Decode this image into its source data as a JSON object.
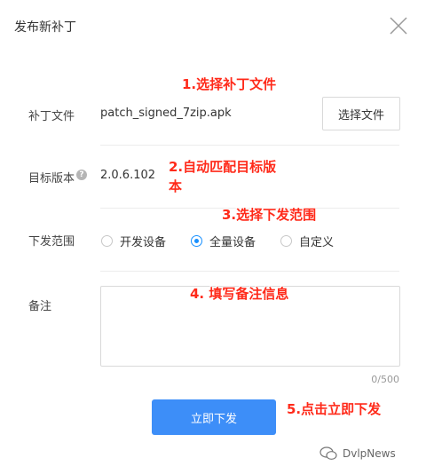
{
  "dialog": {
    "title": "发布新补丁"
  },
  "patch_file": {
    "label": "补丁文件",
    "filename": "patch_signed_7zip.apk",
    "choose_button": "选择文件"
  },
  "target_version": {
    "label": "目标版本",
    "help": "?",
    "value": "2.0.6.102"
  },
  "scope": {
    "label": "下发范围",
    "options": [
      {
        "label": "开发设备",
        "selected": false
      },
      {
        "label": "全量设备",
        "selected": true
      },
      {
        "label": "自定义",
        "selected": false
      }
    ]
  },
  "remark": {
    "label": "备注",
    "value": "",
    "counter": "0/500"
  },
  "submit": {
    "label": "立即下发"
  },
  "annotations": {
    "step1": "1.选择补丁文件",
    "step2_line1": "2.自动匹配目标版",
    "step2_line2": "本",
    "step3": "3.选择下发范围",
    "step4": "4. 填写备注信息",
    "step5": "5.点击立即下发"
  },
  "watermark": {
    "text": "DvlpNews"
  },
  "colors": {
    "primary": "#3d8ef8",
    "radio_accent": "#1890ff",
    "annotation": "#ff2a1a"
  }
}
